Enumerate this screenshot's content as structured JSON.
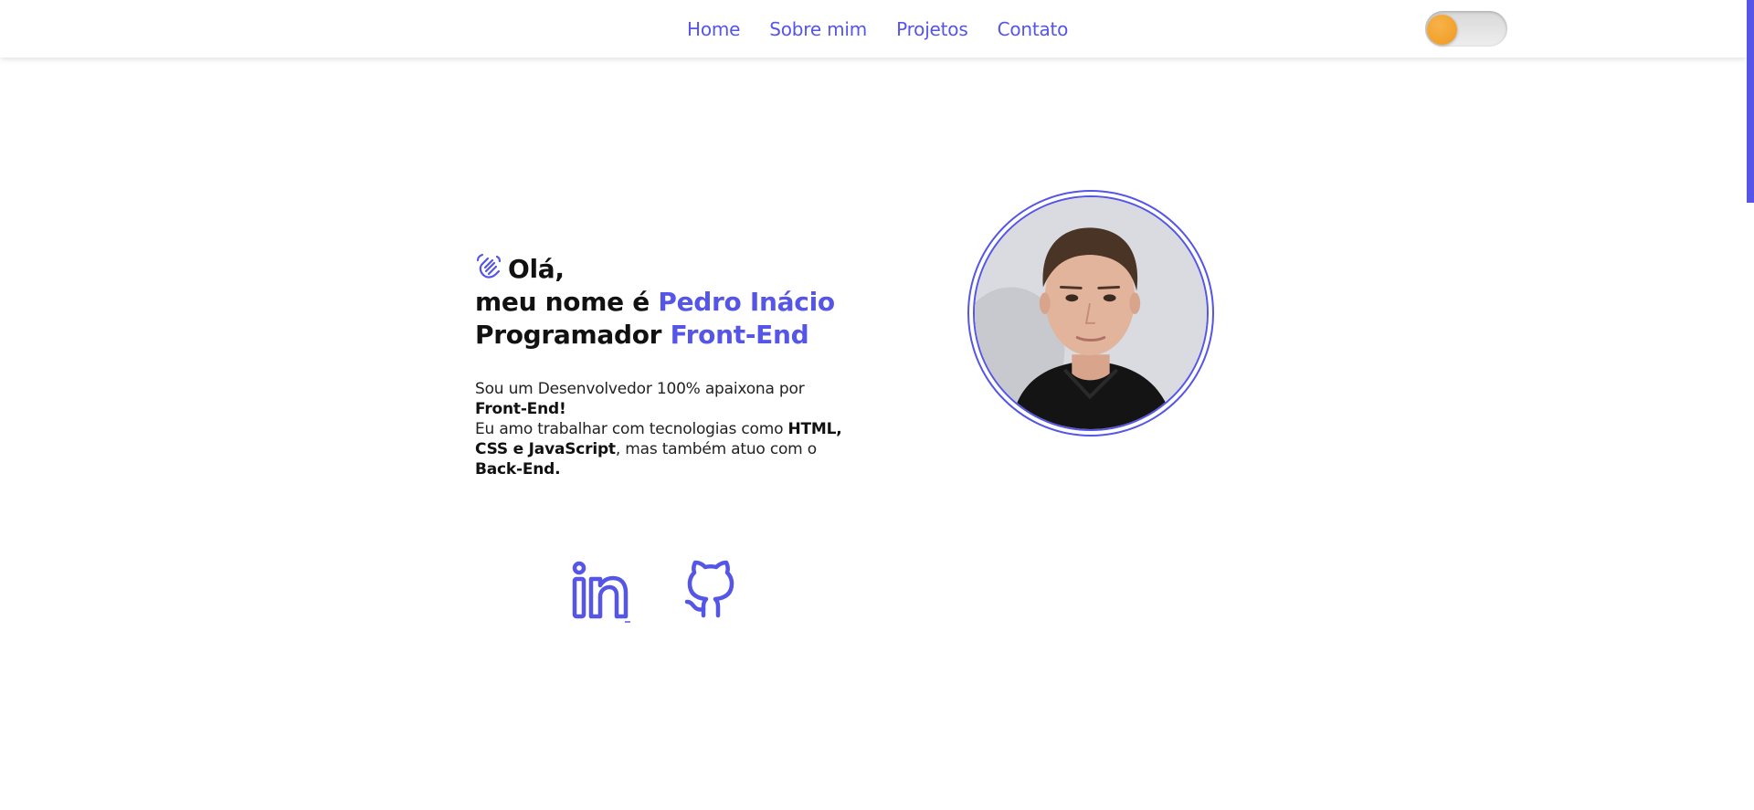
{
  "nav": {
    "items": [
      {
        "label": "Home"
      },
      {
        "label": "Sobre mim"
      },
      {
        "label": "Projetos"
      },
      {
        "label": "Contato"
      }
    ],
    "theme_toggle": {
      "state": "off",
      "knob_color": "#f0a12b"
    }
  },
  "hero": {
    "greeting": "Olá,",
    "name_prefix": "meu nome é ",
    "name": "Pedro Inácio",
    "role_prefix": "Programador ",
    "role": "Front-End",
    "bio": {
      "p1": "Sou um Desenvolvedor 100% apaixona por ",
      "b1": "Front-End!",
      "p2": "Eu amo trabalhar com tecnologias como ",
      "b2": "HTML, CSS e JavaScript",
      "p3": ", mas também atuo com o ",
      "b3": "Back-End."
    },
    "greeting_icon": "waving-hand-icon"
  },
  "social": [
    {
      "icon": "linkedin-icon"
    },
    {
      "icon": "github-icon"
    }
  ],
  "colors": {
    "accent": "#5555e7",
    "text": "#111111",
    "background": "#ffffff"
  }
}
